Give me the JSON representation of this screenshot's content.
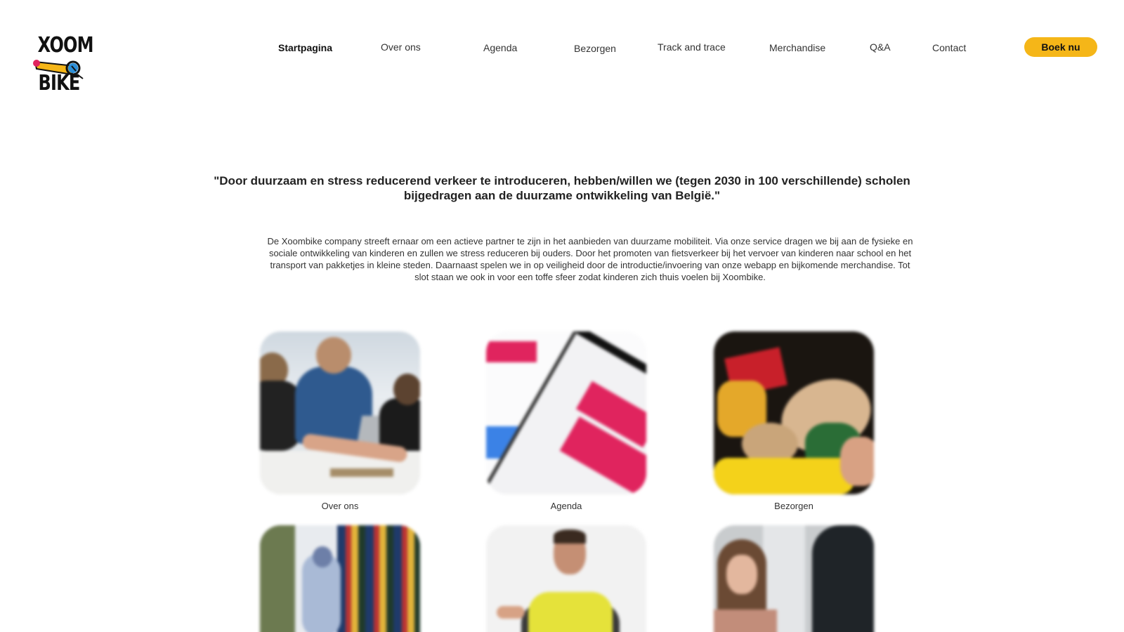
{
  "brand": {
    "logo_top": "XOOM",
    "logo_bottom": "BIKE",
    "accent_color": "#f5b618"
  },
  "nav": {
    "items": [
      {
        "label": "Startpagina",
        "active": true
      },
      {
        "label": "Over ons",
        "active": false
      },
      {
        "label": "Agenda",
        "active": false
      },
      {
        "label": "Bezorgen",
        "active": false
      },
      {
        "label": "Track and trace",
        "active": false
      },
      {
        "label": "Merchandise",
        "active": false
      },
      {
        "label": "Q&A",
        "active": false
      },
      {
        "label": "Contact",
        "active": false
      }
    ],
    "cta_label": "Boek nu"
  },
  "hero": {
    "quote": "\"Door duurzaam en stress reducerend verkeer te introduceren, hebben/willen we (tegen 2030 in 100 verschillende) scholen bijgedragen aan de duurzame ontwikkeling van België.\"",
    "intro": "De Xoombike company streeft ernaar om een actieve partner te zijn in het aanbieden van duurzame mobiliteit. Via onze service dragen we bij aan de fysieke en sociale ontwikkeling van kinderen en zullen we stress reduceren bij ouders. Door het promoten van fietsverkeer bij het vervoer van kinderen naar school en het transport van pakketjes in kleine steden. Daarnaast spelen we in op veiligheid door de introductie/invoering van onze webapp en bijkomende merchandise. Tot slot staan we ook in voor een toffe sfeer zodat kinderen zich thuis voelen bij Xoombike."
  },
  "cards": {
    "row1": [
      {
        "label": "Over ons"
      },
      {
        "label": "Agenda"
      },
      {
        "label": "Bezorgen"
      }
    ]
  }
}
